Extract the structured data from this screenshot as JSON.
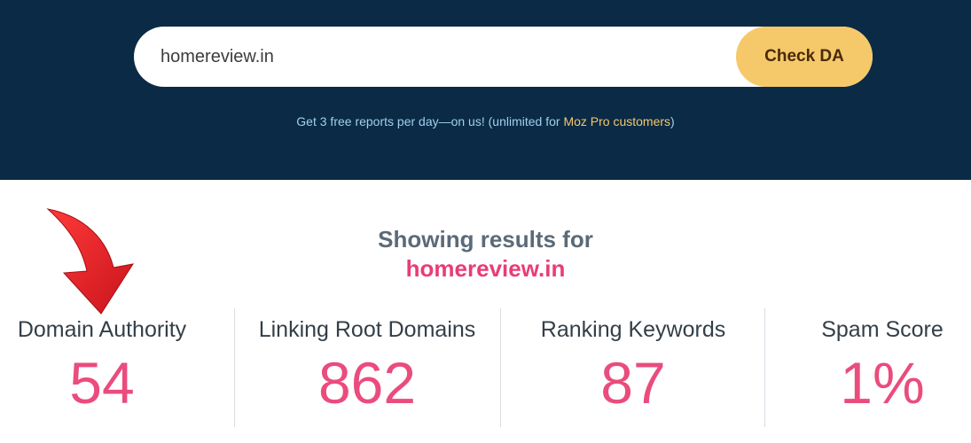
{
  "search": {
    "value": "homereview.in",
    "button_label": "Check DA"
  },
  "free_note": {
    "prefix": "Get 3 free reports per day—on us! (unlimited for ",
    "highlight": "Moz Pro customers",
    "suffix": ")"
  },
  "results": {
    "heading": "Showing results for",
    "domain": "homereview.in"
  },
  "metrics": [
    {
      "label": "Domain Authority",
      "value": "54"
    },
    {
      "label": "Linking Root Domains",
      "value": "862"
    },
    {
      "label": "Ranking Keywords",
      "value": "87"
    },
    {
      "label": "Spam Score",
      "value": "1%"
    }
  ],
  "colors": {
    "hero_bg": "#0b2a45",
    "button_bg": "#f5c96a",
    "accent_pink": "#ea4c7d",
    "arrow_red": "#e8202a"
  },
  "icons": {
    "annotation": "red-curved-arrow-icon"
  }
}
